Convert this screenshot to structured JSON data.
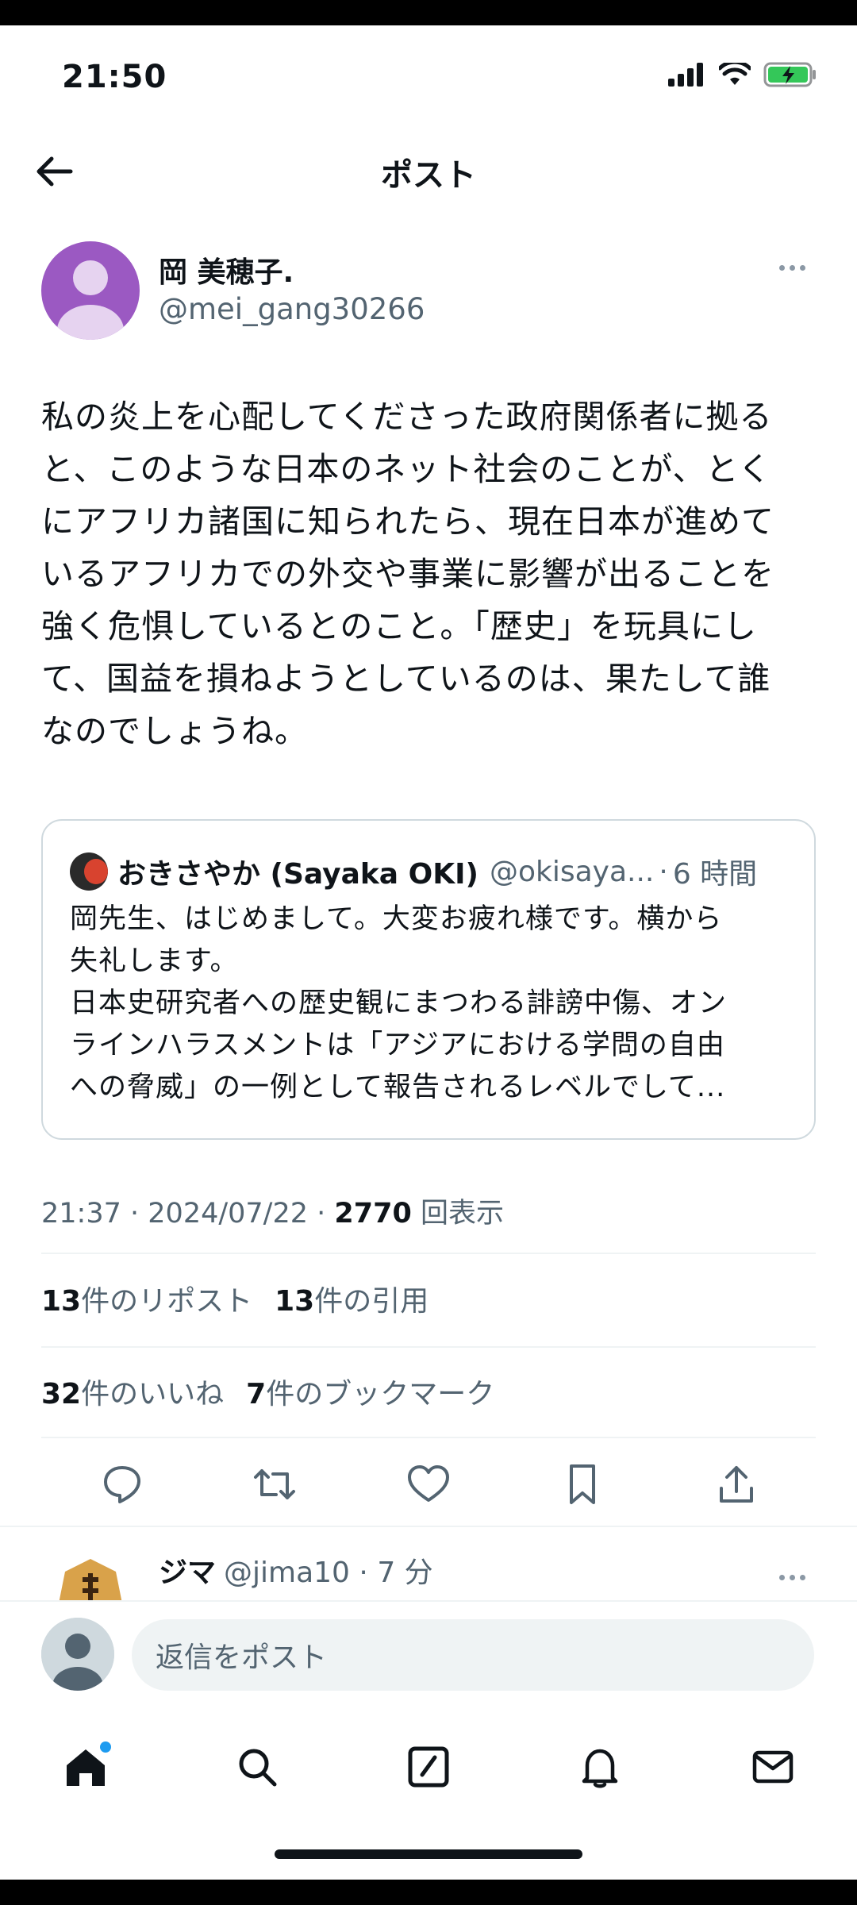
{
  "status_bar": {
    "time": "21:50"
  },
  "header": {
    "title": "ポスト"
  },
  "post": {
    "author_name": "岡 美穂子.",
    "author_handle": "@mei_gang30266",
    "text": "私の炎上を心配してくださった政府関係者に拠る\nと、このような日本のネット社会のことが、とく\nにアフリカ諸国に知られたら、現在日本が進めて\nいるアフリカでの外交や事業に影響が出ることを\n強く危惧しているとのこと。「歴史」を玩具にし\nて、国益を損ねようとしているのは、果たして誰\nなのでしょうね。",
    "quote": {
      "name": "おきさやか (Sayaka OKI)",
      "handle": "@okisaya...",
      "time": "6 時間",
      "text": "岡先生、はじめまして。大変お疲れ様です。横から\n失礼します。\n日本史研究者への歴史観にまつわる誹謗中傷、オン\nラインハラスメントは「アジアにおける学問の自由\nへの脅威」の一例として報告されるレベルでして..."
    },
    "meta": {
      "time": "21:37",
      "date": "2024/07/22",
      "views": "2770",
      "views_label": "回表示"
    },
    "stats": {
      "reposts_count": "13",
      "reposts_label": "件のリポスト",
      "quotes_count": "13",
      "quotes_label": "件の引用",
      "likes_count": "32",
      "likes_label": "件のいいね",
      "bookmarks_count": "7",
      "bookmarks_label": "件のブックマーク"
    }
  },
  "reply_preview": {
    "name": "ジマ",
    "handle": "@jima10",
    "time": "7 分"
  },
  "composer": {
    "placeholder": "返信をポスト"
  },
  "icons": {
    "back": "arrow-left-icon",
    "reply": "speech-bubble-icon",
    "repost": "repost-arrows-icon",
    "like": "heart-icon",
    "bookmark": "bookmark-icon",
    "share": "share-upload-icon",
    "home": "home-icon",
    "search": "search-icon",
    "compose": "compose-icon",
    "notifications": "bell-icon",
    "messages": "envelope-icon"
  },
  "colors": {
    "accent": "#1d9bf0",
    "text": "#0f1419",
    "muted": "#536471",
    "avatar": "#9b59c2"
  }
}
